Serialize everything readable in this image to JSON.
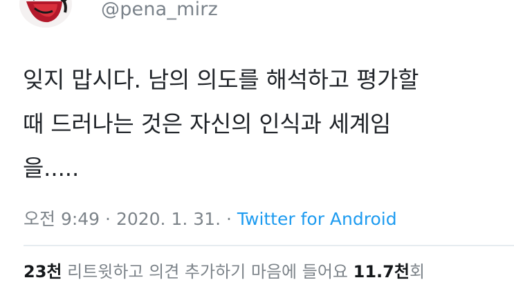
{
  "header": {
    "handle": "@pena_mirz",
    "avatar_icon": "cartoon-avatar-icon"
  },
  "tweet": {
    "lines": [
      "잊지 맙시다. 남의 의도를 해석하고 평가할",
      "때 드러나는 것은 자신의 인식과 세계임",
      "을....."
    ]
  },
  "meta": {
    "time": "오전 9:49",
    "separator1": " · ",
    "date": "2020. 1. 31.",
    "separator2": " · ",
    "source": "Twitter for Android"
  },
  "stats": {
    "retweet_count": "23천",
    "retweet_label": " 리트윗하고 의견 추가하기  ",
    "like_label": "마음에 들어요 ",
    "like_count": "11.7천",
    "like_suffix": "회"
  },
  "colors": {
    "link": "#1d9bf0",
    "text": "#1f2328",
    "muted": "#7c8389"
  }
}
